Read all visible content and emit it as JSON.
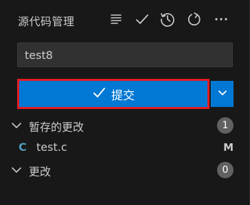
{
  "header": {
    "title": "源代码管理"
  },
  "toolbar": {
    "icons": [
      "view-as-tree-icon",
      "commit-check-icon",
      "history-icon",
      "refresh-icon",
      "more-actions-icon"
    ]
  },
  "commit": {
    "message_value": "test8",
    "button_label": "提交",
    "button_icon": "checkmark-icon",
    "dropdown_icon": "chevron-down-icon"
  },
  "staged": {
    "label": "暂存的更改",
    "count": "1",
    "files": [
      {
        "icon_letter": "C",
        "name": "test.c",
        "status": "M"
      }
    ]
  },
  "changes": {
    "label": "更改",
    "count": "0"
  },
  "colors": {
    "background": "#181818",
    "accent": "#0078d4",
    "highlight_border": "#e51c23",
    "badge": "#616161",
    "c_file_icon": "#519aba"
  }
}
